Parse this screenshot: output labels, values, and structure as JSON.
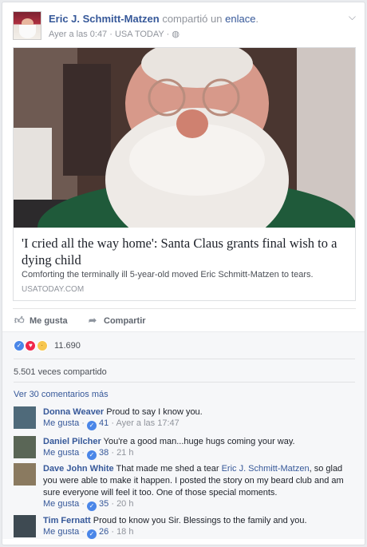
{
  "post": {
    "author": "Eric J. Schmitt-Matzen",
    "shared_text": "compartió un",
    "shared_link_word": "enlace",
    "time": "Ayer a las 0:47",
    "source": "USA TODAY",
    "dot": "·"
  },
  "link": {
    "title": "'I cried all the way home': Santa Claus grants final wish to a dying child",
    "description": "Comforting the terminally ill 5-year-old moved Eric Schmitt-Matzen to tears.",
    "domain": "USATODAY.COM"
  },
  "actions": {
    "like": "Me gusta",
    "share": "Compartir"
  },
  "reactions": {
    "count": "11.690",
    "types": [
      "like-icon",
      "love-icon",
      "sad-icon"
    ]
  },
  "shares": "5.501 veces compartido",
  "view_more": "Ver 30 comentarios más",
  "comment_like_label": "Me gusta",
  "comments": [
    {
      "name": "Donna Weaver",
      "text": "Proud to say I know you.",
      "likes": "41",
      "time": "Ayer a las 17:47"
    },
    {
      "name": "Daniel Pilcher",
      "text": "You're a good man...huge hugs coming your way.",
      "likes": "38",
      "time": "21 h"
    },
    {
      "name": "Dave John White",
      "text_before": "That made me shed a tear",
      "mention": "Eric J. Schmitt-Matzen",
      "text_after": ", so glad you were able to make it happen. I posted the story on my beard club and am sure everyone will feel it too. One of those special moments.",
      "likes": "35",
      "time": "20 h"
    },
    {
      "name": "Tim Fernatt",
      "text": "Proud to know you Sir. Blessings to the family and you.",
      "likes": "26",
      "time": "18 h"
    }
  ],
  "colors": {
    "link_blue": "#365899",
    "meta_gray": "#90949c",
    "like_blue": "#4a86e8",
    "love_red": "#f0284a",
    "sad_yellow": "#f7c64f"
  }
}
